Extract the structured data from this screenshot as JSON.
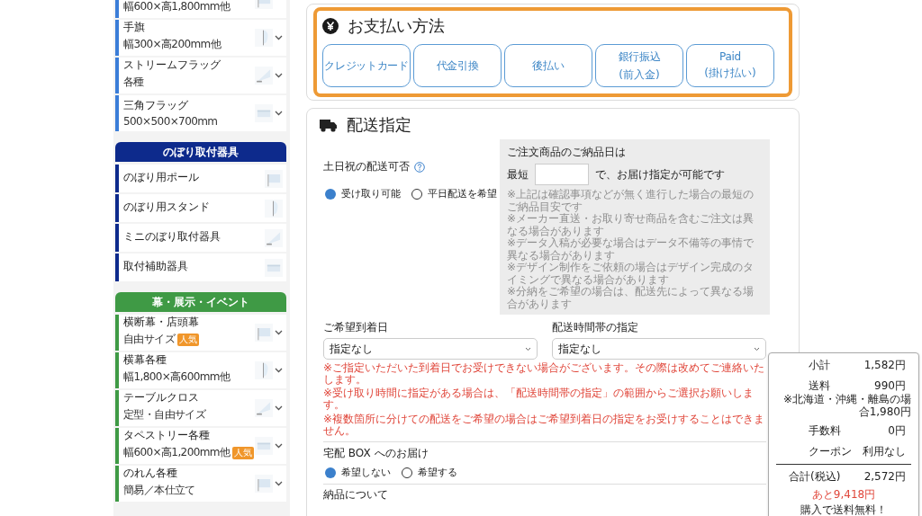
{
  "sidebar": {
    "groups": [
      {
        "color": "#3b7dd8",
        "items": [
          {
            "sub": "幅600×高1,800mm他"
          },
          {
            "label": "手旗",
            "sub": "幅300×高200mm他",
            "expandable": true
          },
          {
            "label": "ストリームフラッグ",
            "sub": "各種",
            "expandable": true
          },
          {
            "label": "三角フラッグ",
            "sub": "500×500×700mm",
            "expandable": true
          }
        ]
      },
      {
        "title": "のぼり取付器具",
        "color": "#0d2a8c",
        "items": [
          {
            "label": "のぼり用ポール",
            "expandable": false
          },
          {
            "label": "のぼり用スタンド",
            "expandable": false
          },
          {
            "label": "ミニのぼり取付器具",
            "expandable": false
          },
          {
            "label": "取付補助器具",
            "expandable": false
          }
        ]
      },
      {
        "title": "幕・展示・イベント",
        "color": "#3f9a45",
        "items": [
          {
            "label": "横断幕・店頭幕",
            "sub": "自由サイズ",
            "badge": "人気",
            "expandable": true
          },
          {
            "label": "横幕各種",
            "sub": "幅1,800×高600mm他",
            "expandable": true
          },
          {
            "label": "テーブルクロス",
            "sub": "定型・自由サイズ",
            "expandable": true
          },
          {
            "label": "タペストリー各種",
            "sub": "幅600×高1,200mm他",
            "badge": "人気",
            "expandable": true
          },
          {
            "label": "のれん各種",
            "sub": "簡易／本仕立て",
            "expandable": true
          }
        ]
      }
    ]
  },
  "payment": {
    "title": "お支払い方法",
    "highlighted": true,
    "options": [
      {
        "label": "クレジットカード"
      },
      {
        "label": "代金引換"
      },
      {
        "label": "後払い"
      },
      {
        "label": "銀行振込",
        "note": "(前入金)"
      },
      {
        "label": "Paid",
        "note": "(掛け払い)"
      }
    ]
  },
  "delivery": {
    "title": "配送指定",
    "weekend": {
      "label": "土日祝の配送可否",
      "options": [
        {
          "label": "受け取り可能",
          "selected": true
        },
        {
          "label": "平日配送を希望",
          "selected": false
        }
      ]
    },
    "lead_time": {
      "heading": "ご注文商品のご納品日は",
      "prefix": "最短",
      "suffix": "で、お届け指定が可能です",
      "notes": [
        "※上記は確認事項などが無く進行した場合の最短のご納品目安です",
        "※メーカー直送・お取り寄せ商品を含むご注文は異なる場合があります",
        "※データ入稿が必要な場合はデータ不備等の事情で異なる場合があります",
        "※デザイン制作をご依頼の場合はデザイン完成のタイミングで異なる場合があります",
        "※分納をご希望の場合は、配送先によって異なる場合があります"
      ]
    },
    "selects": [
      {
        "label": "ご希望到着日",
        "value": "指定なし"
      },
      {
        "label": "配送時間帯の指定",
        "value": "指定なし"
      }
    ],
    "warnings": [
      "※ご指定いただいた到着日でお受けできない場合がございます。その際は改めてご連絡いたします。",
      "※受け取り時間に指定がある場合は、「配送時間帯の指定」の範囲からご選択お願いします。",
      "※複数箇所に分けての配送をご希望の場合はご希望到着日の指定をお受けすることはできません。"
    ],
    "box": {
      "label": "宅配 BOX へのお届け",
      "options": [
        {
          "label": "希望しない",
          "selected": true
        },
        {
          "label": "希望する",
          "selected": false
        }
      ]
    },
    "next_section": "納品について"
  },
  "summary": {
    "rows": [
      {
        "label": "小計",
        "value": "1,582円"
      },
      {
        "label": "送料",
        "value": "990円",
        "note": "※北海道・沖縄・離島の場合1,980円"
      },
      {
        "label": "手数料",
        "value": "0円"
      },
      {
        "label": "クーポン",
        "value": "利用なし"
      }
    ],
    "total_label": "合計(税込)",
    "total_value": "2,572円",
    "free_shipping_amount": "あと9,418円",
    "free_shipping_text": "購入で送料無料！"
  }
}
